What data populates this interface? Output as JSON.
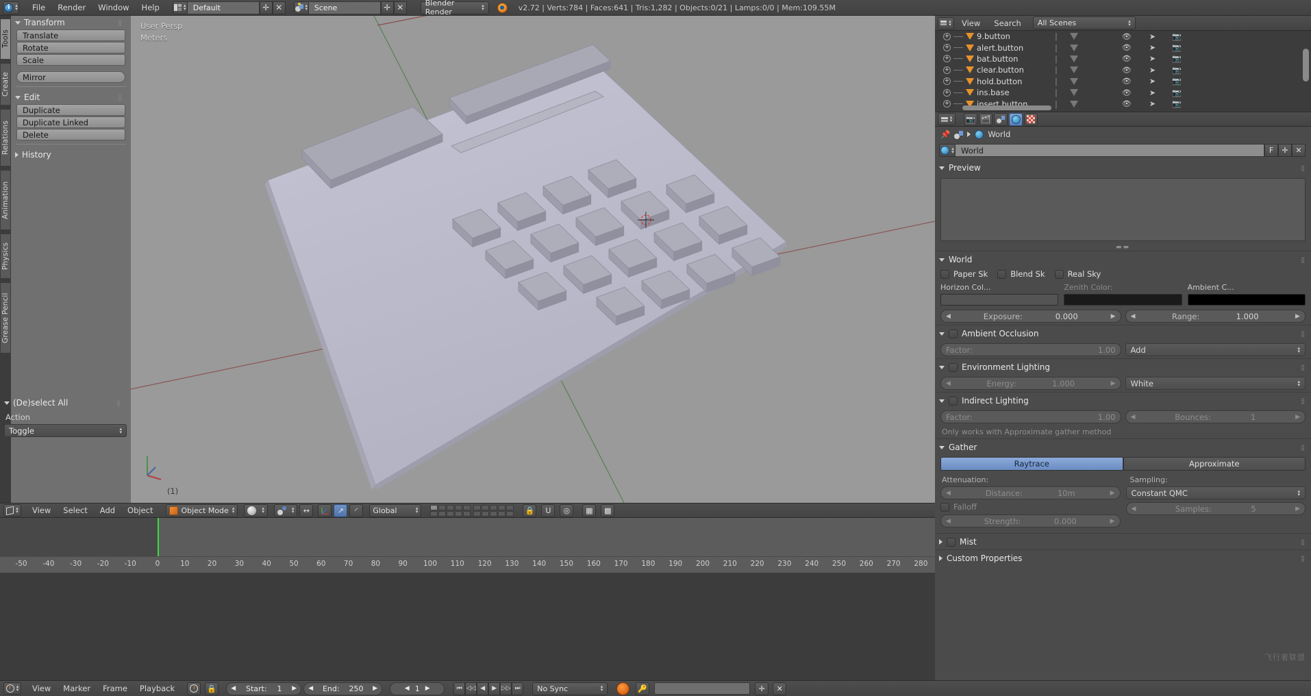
{
  "topbar": {
    "logo_icon": "blender-logo-icon",
    "menus": [
      "File",
      "Render",
      "Window",
      "Help"
    ],
    "screen_layout": "Default",
    "scene_name": "Scene",
    "engine": "Blender Render",
    "stats": "v2.72 | Verts:784 | Faces:641 | Tris:1,282 | Objects:0/21 | Lamps:0/0 | Mem:109.55M"
  },
  "toolshelf": {
    "tabs": [
      {
        "label": "Tools",
        "active": true
      },
      {
        "label": "Create",
        "active": false
      },
      {
        "label": "Relations",
        "active": false
      },
      {
        "label": "Animation",
        "active": false
      },
      {
        "label": "Physics",
        "active": false
      },
      {
        "label": "Grease Pencil",
        "active": false
      }
    ],
    "sections": [
      {
        "title": "Transform",
        "open": true,
        "buttons": [
          "Translate",
          "Rotate",
          "Scale"
        ],
        "buttons2": [
          "Mirror"
        ]
      },
      {
        "title": "Edit",
        "open": true,
        "buttons": [
          "Duplicate",
          "Duplicate Linked",
          "Delete"
        ]
      },
      {
        "title": "History",
        "open": false,
        "buttons": []
      }
    ],
    "operator_panel": {
      "title": "(De)select All",
      "field_label": "Action",
      "field_value": "Toggle"
    }
  },
  "viewport": {
    "perspective_label": "User Persp",
    "unit_label": "Meters",
    "object_label": "(1)",
    "background_color": "#9a9a9a",
    "object_color": "#b4b4c4"
  },
  "viewport_header": {
    "menus": [
      "View",
      "Select",
      "Add",
      "Object"
    ],
    "mode": "Object Mode",
    "transform_orientation": "Global"
  },
  "timeline_ruler": {
    "ticks": [
      "-50",
      "-40",
      "-30",
      "-20",
      "-10",
      "0",
      "10",
      "20",
      "30",
      "40",
      "50",
      "60",
      "70",
      "80",
      "90",
      "100",
      "110",
      "120",
      "130",
      "140",
      "150",
      "160",
      "170",
      "180",
      "190",
      "200",
      "210",
      "220",
      "230",
      "240",
      "250",
      "260",
      "270",
      "280"
    ]
  },
  "timeline_header": {
    "menus": [
      "View",
      "Marker",
      "Frame",
      "Playback"
    ],
    "start_label": "Start:",
    "start_value": "1",
    "end_label": "End:",
    "end_value": "250",
    "current_frame": "1",
    "sync_mode": "No Sync"
  },
  "outliner": {
    "header_menus": [
      "View",
      "Search"
    ],
    "display_mode": "All Scenes",
    "rows": [
      {
        "name": "9.button"
      },
      {
        "name": "alert.button"
      },
      {
        "name": "bat.button"
      },
      {
        "name": "clear.button"
      },
      {
        "name": "hold.button"
      },
      {
        "name": "ins.base"
      },
      {
        "name": "insert.button"
      }
    ]
  },
  "properties": {
    "context_tabs": [
      "render-icon",
      "render-layers-icon",
      "scene-icon",
      "world-icon",
      "texture-icon"
    ],
    "active_context": "world-icon",
    "breadcrumb": "World",
    "datablock_name": "World",
    "datablock_fake_user": "F",
    "sections": {
      "preview": {
        "title": "Preview"
      },
      "world": {
        "title": "World",
        "checkboxes": [
          "Paper Sk",
          "Blend Sk",
          "Real Sky"
        ],
        "color_labels": [
          "Horizon Col...",
          "Zenith Color:",
          "Ambient C..."
        ],
        "colors": [
          "#545454",
          "#1a1a1a",
          "#000000"
        ],
        "exposure_label": "Exposure:",
        "exposure_value": "0.000",
        "range_label": "Range:",
        "range_value": "1.000"
      },
      "ambient_occlusion": {
        "title": "Ambient Occlusion",
        "factor_label": "Factor:",
        "factor_value": "1.00",
        "blend_mode": "Add"
      },
      "environment_lighting": {
        "title": "Environment Lighting",
        "energy_label": "Energy:",
        "energy_value": "1.000",
        "color_source": "White"
      },
      "indirect_lighting": {
        "title": "Indirect Lighting",
        "factor_label": "Factor:",
        "factor_value": "1.00",
        "bounces_label": "Bounces:",
        "bounces_value": "1",
        "note": "Only works with Approximate gather method"
      },
      "gather": {
        "title": "Gather",
        "method_raytrace": "Raytrace",
        "method_approximate": "Approximate",
        "active_method": "Raytrace",
        "attenuation_label": "Attenuation:",
        "sampling_label": "Sampling:",
        "distance_label": "Distance:",
        "distance_value": "10m",
        "sampling_type": "Constant QMC",
        "falloff_label": "Falloff",
        "samples_label": "Samples:",
        "samples_value": "5",
        "strength_label": "Strength:",
        "strength_value": "0.000"
      },
      "mist": {
        "title": "Mist"
      },
      "custom_properties": {
        "title": "Custom Properties"
      }
    }
  },
  "accent": {
    "blue": "#6b8dc4",
    "orange": "#e8922c",
    "green": "#3ddb3d",
    "red": "#9b2020"
  }
}
